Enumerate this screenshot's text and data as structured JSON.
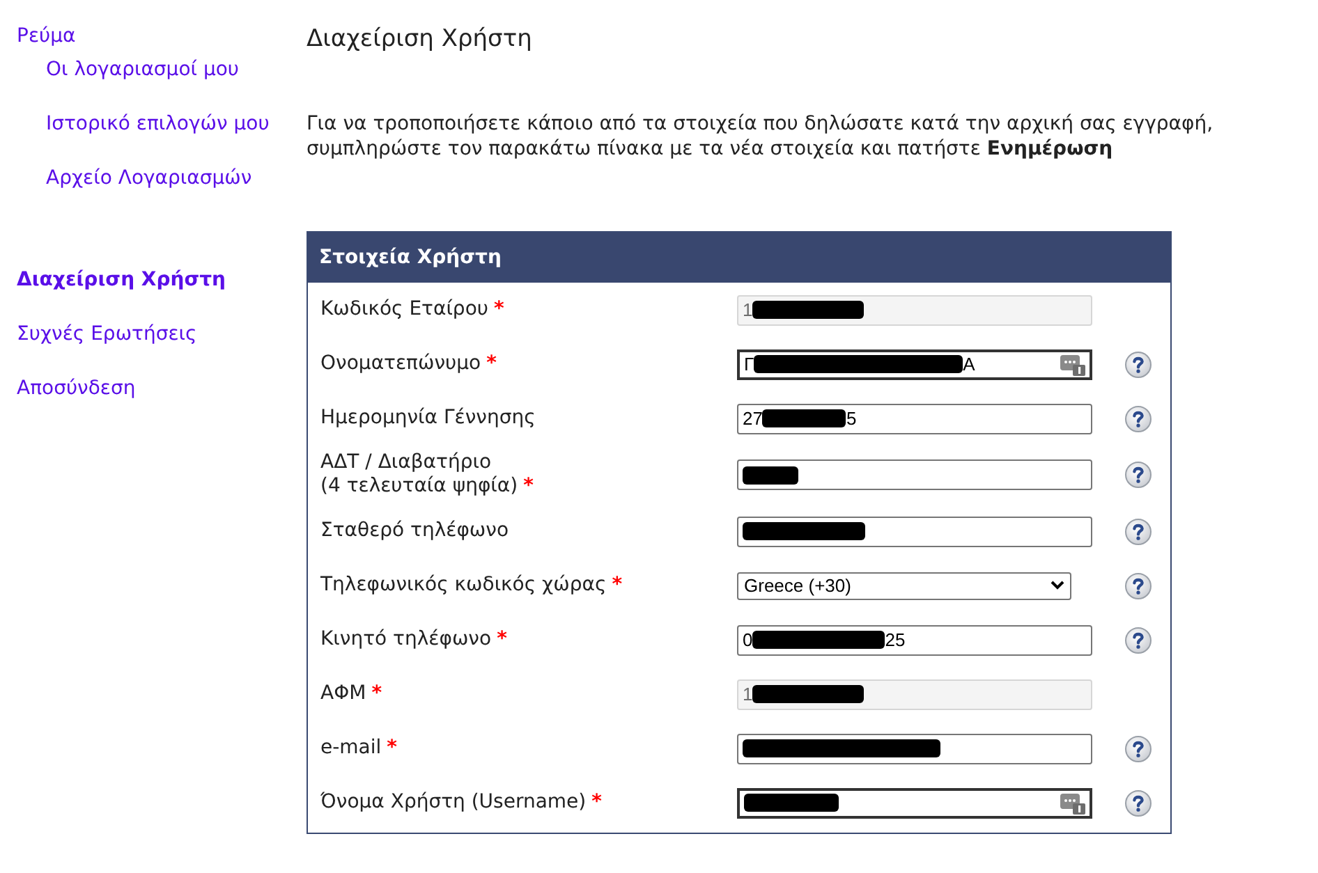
{
  "sidebar": {
    "items": [
      {
        "label": "Ρεύμα",
        "selected": false,
        "children": [
          {
            "label": "Οι λογαριασμοί μου",
            "selected": false
          },
          {
            "label": "Ιστορικό επιλογών μου",
            "selected": false
          },
          {
            "label": "Αρχείο Λογαριασμών",
            "selected": false
          }
        ]
      },
      {
        "label": "Διαχείριση Χρήστη",
        "selected": true
      },
      {
        "label": "Συχνές Ερωτήσεις",
        "selected": false
      },
      {
        "label": "Αποσύνδεση",
        "selected": false
      }
    ]
  },
  "page": {
    "title": "Διαχείριση Χρήστη",
    "intro": "Για να τροποποιήσετε κάποιο από τα στοιχεία που δηλώσατε κατά την αρχική σας εγγραφή, συμπληρώστε τον παρακάτω πίνακα με τα νέα στοιχεία και πατήστε **Ενημέρωση**"
  },
  "form": {
    "title": "Στοιχεία Χρήστη",
    "fields": [
      {
        "kind": "text",
        "label": "Κωδικός Εταίρου",
        "required_mark": "*",
        "disabled": true,
        "value_start": "1",
        "autofill": false,
        "help": false
      },
      {
        "kind": "text",
        "label": "Ονοματεπώνυμο",
        "required_mark": "*",
        "disabled": false,
        "value_start": "Γ",
        "value_end": "Α",
        "autofill": true,
        "help": true
      },
      {
        "kind": "text",
        "label": "Ημερομηνία Γέννησης",
        "disabled": false,
        "value_start": "27",
        "value_end": "5",
        "autofill": false,
        "help": true
      },
      {
        "kind": "text",
        "label": "ΑΔΤ / Διαβατήριο",
        "label_2": "(4 τελευταία ψηφία)",
        "required_mark": "*",
        "disabled": false,
        "autofill": false,
        "help": true
      },
      {
        "kind": "text",
        "label": "Σταθερό τηλέφωνο",
        "disabled": false,
        "autofill": false,
        "help": true
      },
      {
        "kind": "select",
        "label": "Τηλεφωνικός κωδικός χώρας",
        "required_mark": "*",
        "disabled": false,
        "value": "Greece (+30)",
        "help": true
      },
      {
        "kind": "text",
        "label": "Κινητό τηλέφωνο",
        "required_mark": "*",
        "disabled": false,
        "value_start": "0",
        "value_end": "25",
        "autofill": false,
        "help": true
      },
      {
        "kind": "text",
        "label": "ΑΦΜ",
        "required_mark": "*",
        "disabled": true,
        "value_start": "1",
        "autofill": false,
        "help": false
      },
      {
        "kind": "text",
        "label": "e-mail",
        "required_mark": "*",
        "disabled": false,
        "autofill": false,
        "help": true
      },
      {
        "kind": "text",
        "label": "Όνομα Χρήστη (Username)",
        "required_mark": "*",
        "disabled": false,
        "autofill": true,
        "help": true
      }
    ]
  }
}
